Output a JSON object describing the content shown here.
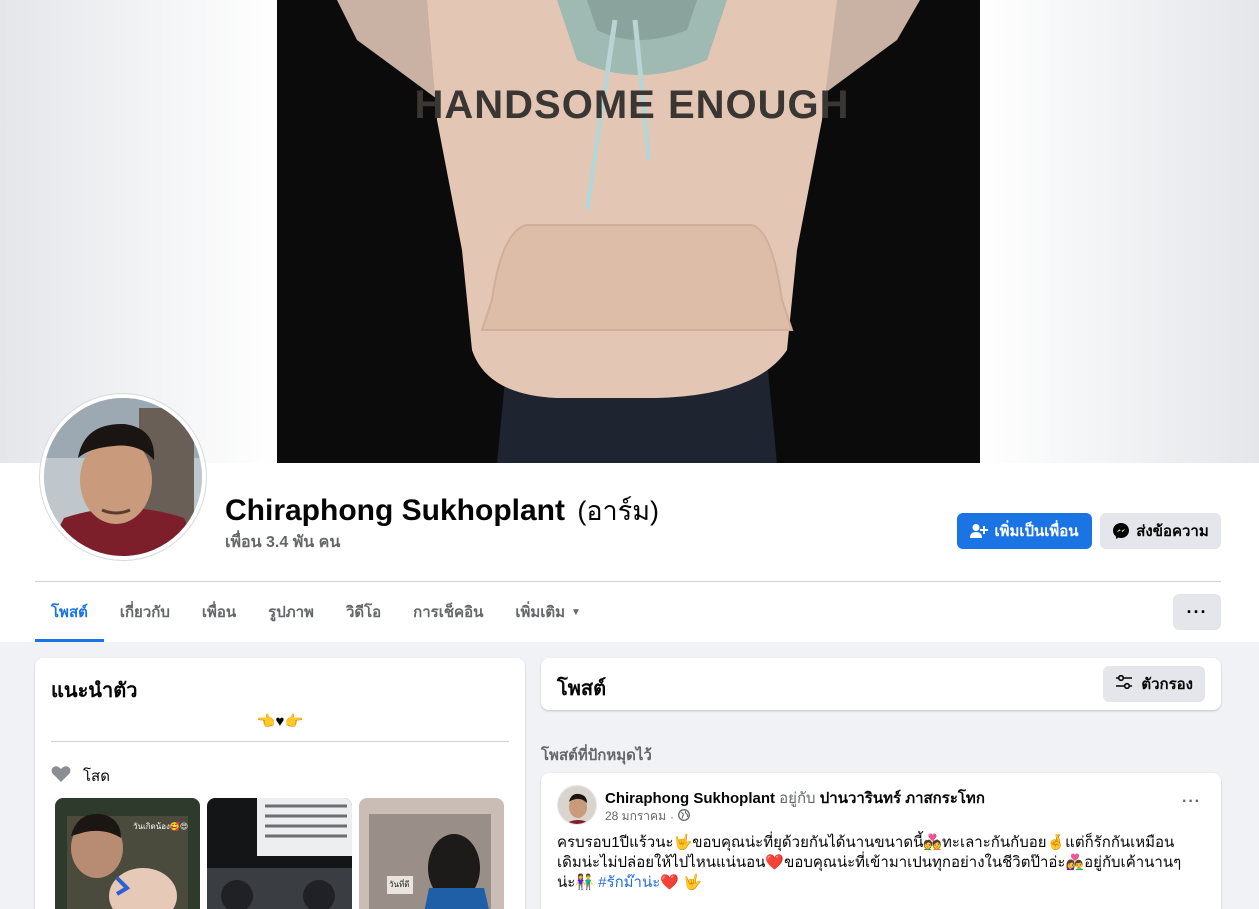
{
  "profile": {
    "name": "Chiraphong Sukhoplant",
    "alternate_name": "(อาร์ม)",
    "friends_count": "เพื่อน 3.4 พัน คน"
  },
  "cover": {
    "shirt_print": "HANDSOME ENOUGH"
  },
  "actions": {
    "add_friend_label": "เพิ่มเป็นเพื่อน",
    "message_label": "ส่งข้อความ",
    "more_label": "···"
  },
  "tabs": [
    {
      "label": "โพสต์",
      "active": true
    },
    {
      "label": "เกี่ยวกับ"
    },
    {
      "label": "เพื่อน"
    },
    {
      "label": "รูปภาพ"
    },
    {
      "label": "วิดีโอ"
    },
    {
      "label": "การเช็คอิน"
    },
    {
      "label": "เพิ่มเติม"
    }
  ],
  "intro": {
    "title": "แนะนำตัว",
    "bio": "👈♥👉",
    "relationship": "โสด",
    "featured": [
      {
        "caption": "วันเกิดน้อง🥰😍"
      },
      {
        "caption": ""
      },
      {
        "caption": "วันที่ดี"
      }
    ]
  },
  "posts": {
    "title": "โพสต์",
    "filter_label": "ตัวกรอง",
    "pinned_label": "โพสต์ที่ปักหมุดไว้"
  },
  "pinned_post": {
    "author": "Chiraphong Sukhoplant",
    "with_label": "อยู่กับ",
    "tagged": "ปานวารินทร์ ภาสกระโทก",
    "date": "28 มกราคม",
    "separator": "·",
    "more_label": "···",
    "text_main": "ครบรอบ1ปีแร้วนะ🤟ขอบคุณน่ะที่ยุด้วยกันได้นานขนาดนี้💑ทะเลาะกันกับอย🤞แต่ก็รักกันเหมือนเดิมน่ะไม่ปล่อยให้ไปไหนแน่นอน❤️ขอบคุณน่ะที่เข้ามาเปนทุกอย่างในชีวิตป๊าอ่ะ👩‍❤️‍👨อยู่กับเค้านานๆน่ะ👫",
    "hashtag": "#รักม๊าน่ะ❤️",
    "text_end": "🤟"
  },
  "colors": {
    "accent": "#1b74e4",
    "page_bg": "#f0f2f5",
    "secondary_text": "#65676b"
  }
}
